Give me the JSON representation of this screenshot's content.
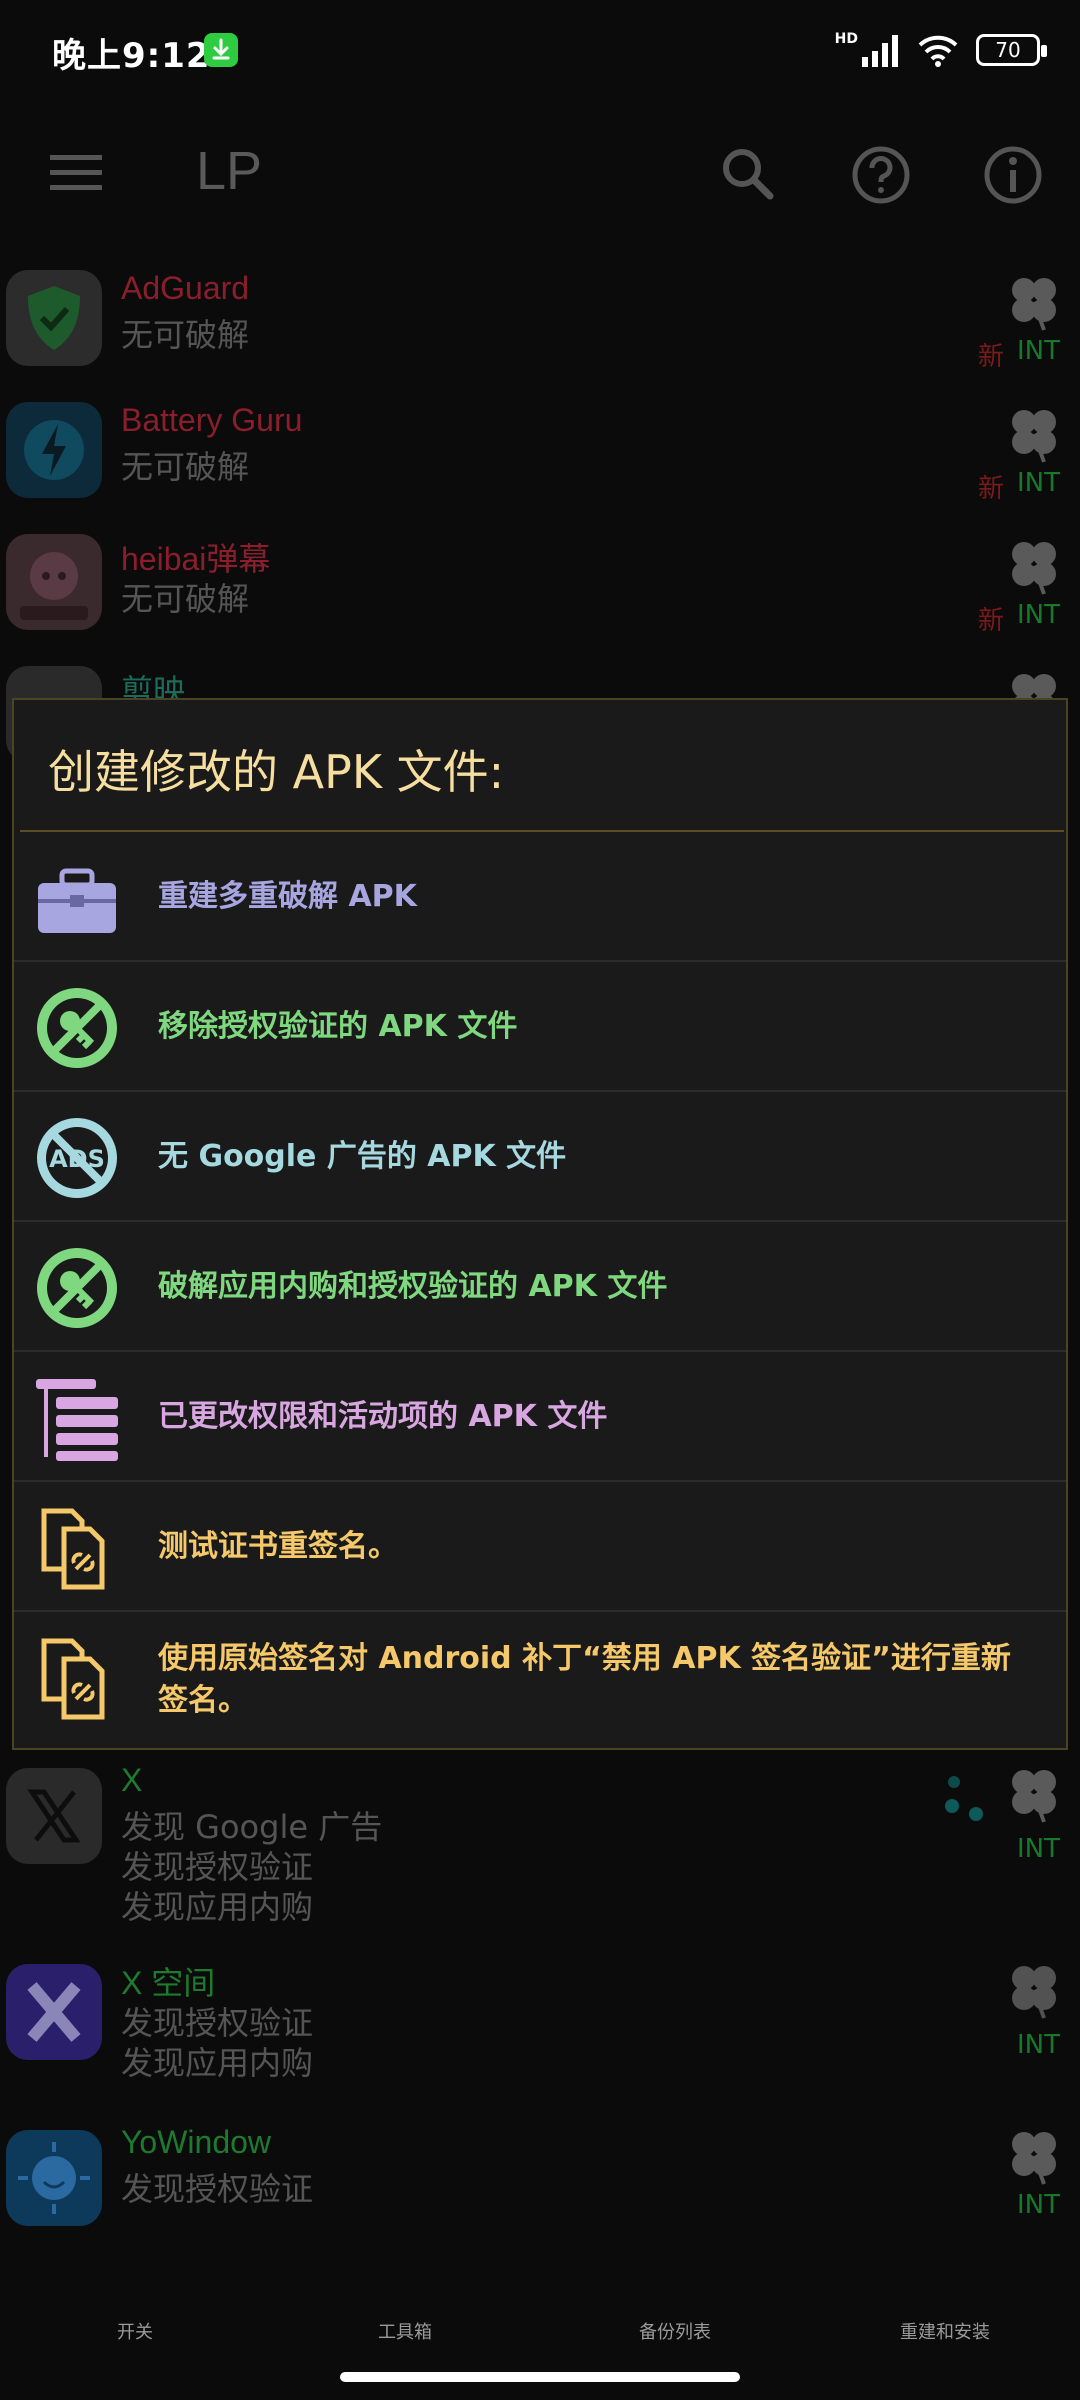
{
  "status": {
    "time": "晚上9:12",
    "battery": "70",
    "network": "HD"
  },
  "appbar": {
    "title": "LP"
  },
  "apps": [
    {
      "name": "AdGuard",
      "statuses": [
        "无可破解"
      ],
      "name_color": "#8a1e2c",
      "is_new": true,
      "new_label": "新",
      "int_label": "INT"
    },
    {
      "name": "Battery Guru",
      "statuses": [
        "无可破解"
      ],
      "name_color": "#8a1e2c",
      "is_new": true,
      "new_label": "新",
      "int_label": "INT"
    },
    {
      "name": "heibai弹幕",
      "statuses": [
        "无可破解"
      ],
      "name_color": "#8a1e2c",
      "is_new": true,
      "new_label": "新",
      "int_label": "INT"
    },
    {
      "name": "剪映",
      "statuses": [],
      "name_color": "#1d6b5a",
      "is_new": false,
      "int_label": ""
    },
    {
      "name": "X",
      "statuses": [
        "发现 Google 广告",
        "发现授权验证",
        "发现应用内购"
      ],
      "name_color": "#1e7a2e",
      "is_new": false,
      "int_label": "INT"
    },
    {
      "name": "X 空间",
      "statuses": [
        "发现授权验证",
        "发现应用内购"
      ],
      "name_color": "#1e7a2e",
      "is_new": false,
      "int_label": "INT"
    },
    {
      "name": "YoWindow",
      "statuses": [
        "发现授权验证"
      ],
      "name_color": "#1e7a2e",
      "is_new": false,
      "int_label": "INT"
    }
  ],
  "dialog": {
    "title": "创建修改的 APK 文件:",
    "options": [
      {
        "label": "重建多重破解 APK",
        "color": "#a8a6e0",
        "icon": "toolbox-icon"
      },
      {
        "label": "移除授权验证的 APK 文件",
        "color": "#7fd87f",
        "icon": "no-key-icon"
      },
      {
        "label": "无 Google 广告的 APK 文件",
        "color": "#a6d8e0",
        "icon": "no-ads-icon"
      },
      {
        "label": "破解应用内购和授权验证的 APK 文件",
        "color": "#7fd87f",
        "icon": "no-key-icon"
      },
      {
        "label": "已更改权限和活动项的 APK 文件",
        "color": "#d8a6e0",
        "icon": "permissions-list-icon"
      },
      {
        "label": "测试证书重签名。",
        "color": "#f5c86a",
        "icon": "certificate-files-icon"
      },
      {
        "label": "使用原始签名对 Android 补丁“禁用 APK 签名验证”进行重新签名。",
        "color": "#f5c86a",
        "icon": "certificate-files-icon"
      }
    ]
  },
  "bottom_nav": [
    {
      "label": "开关"
    },
    {
      "label": "工具箱"
    },
    {
      "label": "备份列表"
    },
    {
      "label": "重建和安装"
    }
  ]
}
